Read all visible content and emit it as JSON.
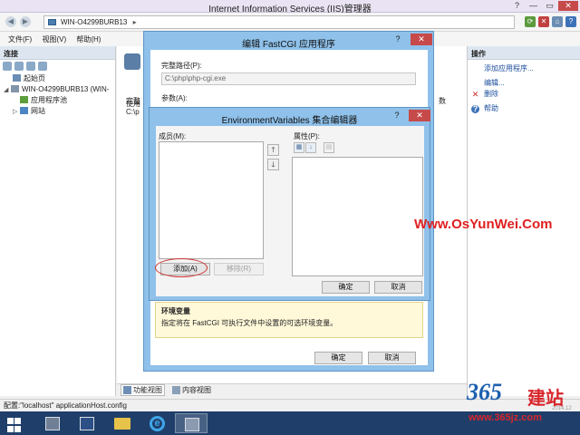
{
  "window": {
    "title": "Internet Information Services (IIS)管理器",
    "buttons": [
      "?",
      "—",
      "▭",
      "✕"
    ]
  },
  "address": {
    "path": "WIN-O4299BURB13",
    "separator": "▸"
  },
  "menu": [
    "文件(F)",
    "视图(V)",
    "帮助(H)"
  ],
  "left_panel": {
    "header": "连接",
    "tree": [
      {
        "label": "起始页",
        "level": 1,
        "toggle": ""
      },
      {
        "label": "WIN-O4299BURB13 (WIN-",
        "level": 0,
        "toggle": "◢"
      },
      {
        "label": "应用程序池",
        "level": 2,
        "toggle": ""
      },
      {
        "label": "网站",
        "level": 1,
        "toggle": "▷"
      }
    ]
  },
  "right_panel": {
    "header": "操作",
    "actions": [
      {
        "label": "添加应用程序...",
        "icon": ""
      },
      {
        "label": "编辑...",
        "icon": ""
      },
      {
        "label": "删除",
        "icon": "✕"
      },
      {
        "label": "帮助",
        "icon": "?"
      }
    ]
  },
  "center": {
    "use_label": "使用",
    "col_complete": "完整",
    "col_count": "数",
    "path_stub": "C:\\p",
    "info_title": "环境变量",
    "info_text": "指定将在 FastCGI 可执行文件中设置的可选环境变量。"
  },
  "bottom_tabs": [
    "功能视图",
    "内容视图"
  ],
  "statusbar": "配置:\"localhost\" applicationHost.config",
  "dialog_edit": {
    "title": "编辑 FastCGI 应用程序",
    "full_path_label": "完整路径(P):",
    "full_path_value": "C:\\php\\php-cgi.exe",
    "args_label": "参数(A):",
    "ok": "确定",
    "cancel": "取消",
    "help_btn": "?",
    "close_btn": "✕"
  },
  "dialog_env": {
    "title": "EnvironmentVariables 集合编辑器",
    "members_label": "成员(M):",
    "props_label": "属性(P):",
    "add": "添加(A)",
    "remove": "移除(R)",
    "ok": "确定",
    "cancel": "取消",
    "up": "🡑",
    "down": "🡓",
    "help_btn": "?",
    "close_btn": "✕"
  },
  "watermark": {
    "url": "Www.OsYunWei.Com",
    "logo_num": "365",
    "logo_text": "建站",
    "logo_site": "www.365jz.com",
    "logo_date": "2014.12"
  },
  "colors": {
    "dialog_frame": "#8fc1ea",
    "close_red": "#c74a4a",
    "taskbar": "#1f3f6a",
    "watermark_red": "#e02020"
  }
}
